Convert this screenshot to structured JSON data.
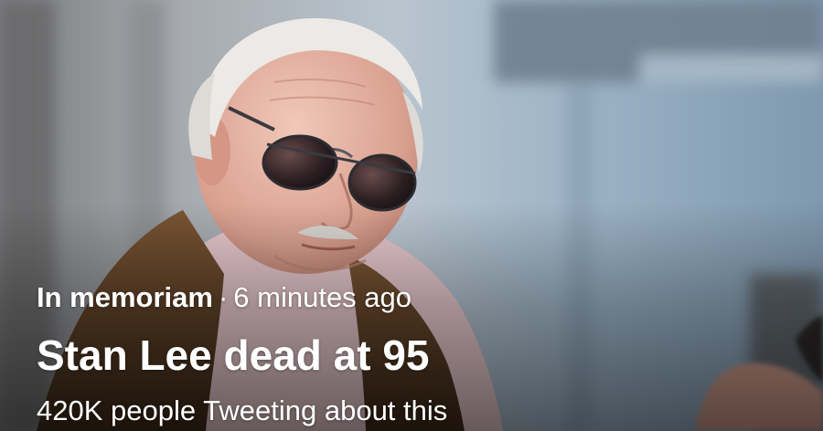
{
  "trend_card": {
    "category": "In memoriam",
    "separator": "·",
    "time_ago": "6 minutes ago",
    "headline": "Stan Lee dead at 95",
    "tweet_count_text": "420K people Tweeting about this"
  },
  "colors": {
    "text": "#ffffff",
    "vest": "#6b4a2c",
    "shirt": "#e7c8cd",
    "background_blue": "#9ab3c7"
  }
}
